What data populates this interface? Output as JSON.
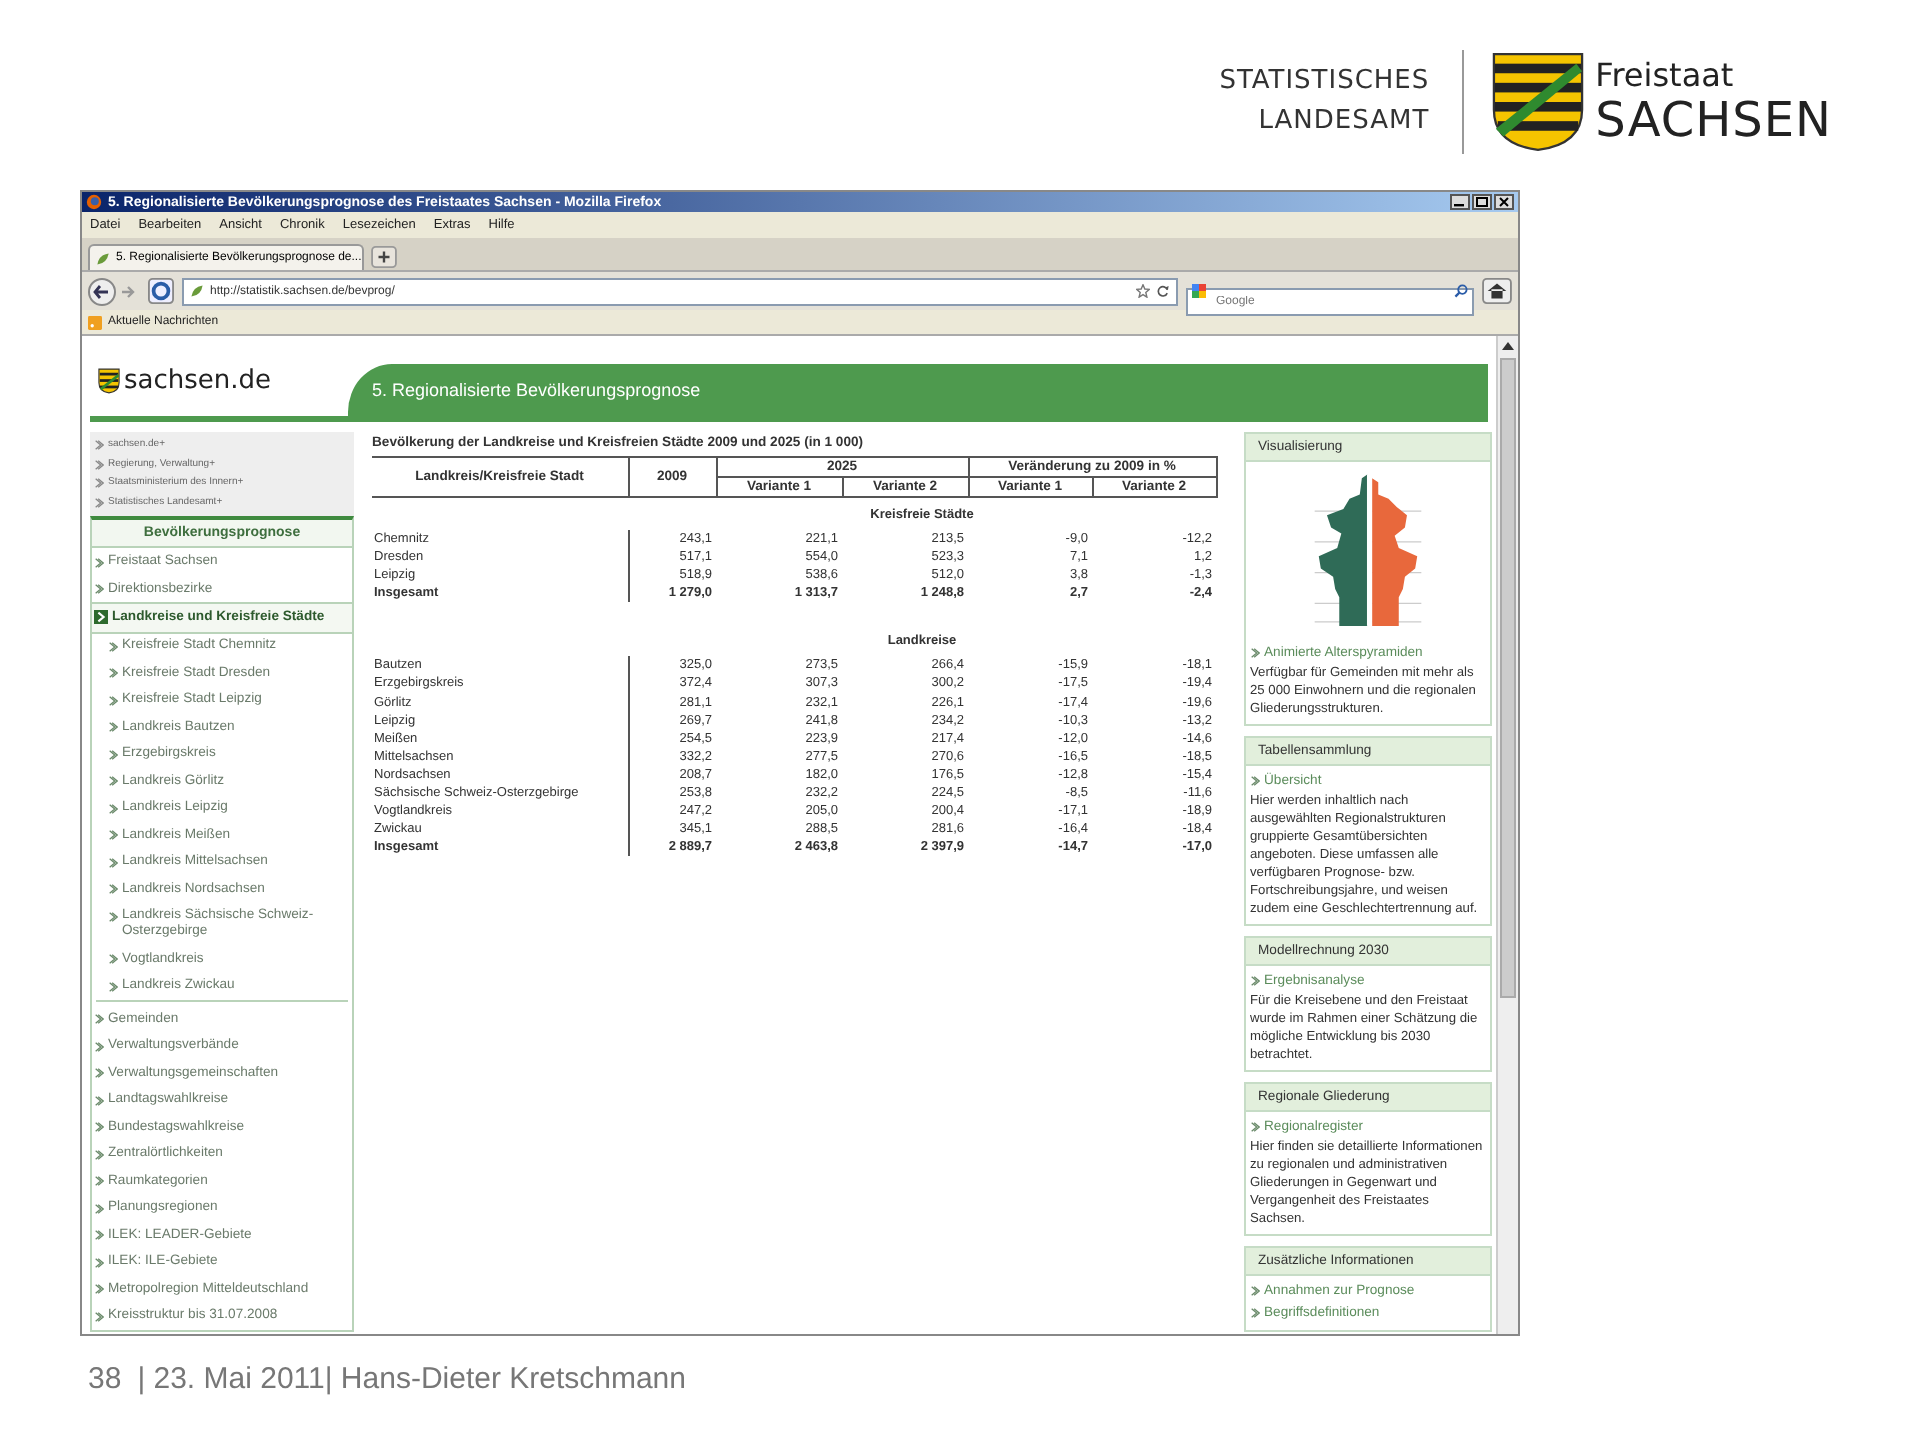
{
  "slide_header": {
    "office": [
      "STATISTISCHES",
      "LANDESAMT"
    ],
    "state": [
      "Freistaat",
      "SACHSEN"
    ]
  },
  "browser": {
    "title": "5. Regionalisierte Bevölkerungsprognose des Freistaates Sachsen - Mozilla Firefox",
    "menu": [
      "Datei",
      "Bearbeiten",
      "Ansicht",
      "Chronik",
      "Lesezeichen",
      "Extras",
      "Hilfe"
    ],
    "tab": "5. Regionalisierte Bevölkerungsprognose de...",
    "url": "http://statistik.sachsen.de/bevprog/",
    "search": {
      "placeholder": "Google"
    },
    "bookmarks": [
      "Aktuelle Nachrichten"
    ]
  },
  "site": {
    "logo": "sachsen.de",
    "banner": "5. Regionalisierte Bevölkerungsprognose"
  },
  "sidebar": {
    "top_links": [
      "sachsen.de+",
      "Regierung, Verwaltung+",
      "Staatsministerium des Innern+",
      "Statistisches Landesamt+"
    ],
    "heading": "Bevölkerungsprognose",
    "items": [
      {
        "label": "Freistaat Sachsen",
        "selected": false
      },
      {
        "label": "Direktionsbezirke",
        "selected": false
      },
      {
        "label": "Landkreise und Kreisfreie Städte",
        "selected": true,
        "children": [
          {
            "label": "Kreisfreie Stadt Chemnitz",
            "selected": false
          },
          {
            "label": "Kreisfreie Stadt Dresden",
            "selected": false
          },
          {
            "label": "Kreisfreie Stadt Leipzig",
            "selected": false
          },
          {
            "label": "Landkreis Bautzen",
            "selected": false
          },
          {
            "label": "Erzgebirgskreis",
            "selected": false
          },
          {
            "label": "Landkreis Görlitz",
            "selected": false
          },
          {
            "label": "Landkreis Leipzig",
            "selected": false
          },
          {
            "label": "Landkreis Meißen",
            "selected": false
          },
          {
            "label": "Landkreis Mittelsachsen",
            "selected": false
          },
          {
            "label": "Landkreis Nordsachsen",
            "selected": false
          },
          {
            "label": "Landkreis Sächsische Schweiz-Osterzgebirge",
            "selected": false
          },
          {
            "label": "Vogtlandkreis",
            "selected": false
          },
          {
            "label": "Landkreis Zwickau",
            "selected": false
          }
        ]
      },
      {
        "label": "Gemeinden",
        "selected": false
      },
      {
        "label": "Verwaltungsverbände",
        "selected": false
      },
      {
        "label": "Verwaltungsgemeinschaften",
        "selected": false
      },
      {
        "label": "Landtagswahlkreise",
        "selected": false
      },
      {
        "label": "Bundestagswahlkreise",
        "selected": false
      },
      {
        "label": "Zentralörtlichkeiten",
        "selected": false
      },
      {
        "label": "Raumkategorien",
        "selected": false
      },
      {
        "label": "Planungsregionen",
        "selected": false
      },
      {
        "label": "ILEK: LEADER-Gebiete",
        "selected": false
      },
      {
        "label": "ILEK: ILE-Gebiete",
        "selected": false
      },
      {
        "label": "Metropolregion Mitteldeutschland",
        "selected": false
      },
      {
        "label": "Kreisstruktur bis 31.07.2008",
        "selected": false
      }
    ]
  },
  "table": {
    "caption": "Bevölkerung der Landkreise und Kreisfreien Städte 2009 und 2025 (in 1 000)",
    "header": {
      "name": "Landkreis/Kreisfreie Stadt",
      "base": "2009",
      "groups": [
        "2025",
        "Veränderung zu 2009 in %"
      ],
      "variants": [
        "Variante 1",
        "Variante 2",
        "Variante 1",
        "Variante 2"
      ]
    },
    "sections": [
      {
        "title": "Kreisfreie Städte",
        "rows": [
          {
            "name": "Chemnitz",
            "values": [
              "243,1",
              "221,1",
              "213,5",
              "-9,0",
              "-12,2"
            ],
            "total": false
          },
          {
            "name": "Dresden",
            "values": [
              "517,1",
              "554,0",
              "523,3",
              "7,1",
              "1,2"
            ],
            "total": false
          },
          {
            "name": "Leipzig",
            "values": [
              "518,9",
              "538,6",
              "512,0",
              "3,8",
              "-1,3"
            ],
            "total": false
          },
          {
            "name": "Insgesamt",
            "values": [
              "1 279,0",
              "1 313,7",
              "1 248,8",
              "2,7",
              "-2,4"
            ],
            "total": true
          }
        ]
      },
      {
        "title": "Landkreise",
        "rows": [
          {
            "name": "Bautzen",
            "values": [
              "325,0",
              "273,5",
              "266,4",
              "-15,9",
              "-18,1"
            ],
            "total": false
          },
          {
            "name": "Erzgebirgskreis",
            "values": [
              "372,4",
              "307,3",
              "300,2",
              "-17,5",
              "-19,4"
            ],
            "total": false
          },
          {
            "name": "Görlitz",
            "values": [
              "281,1",
              "232,1",
              "226,1",
              "-17,4",
              "-19,6"
            ],
            "total": false
          },
          {
            "name": "Leipzig",
            "values": [
              "269,7",
              "241,8",
              "234,2",
              "-10,3",
              "-13,2"
            ],
            "total": false
          },
          {
            "name": "Meißen",
            "values": [
              "254,5",
              "223,9",
              "217,4",
              "-12,0",
              "-14,6"
            ],
            "total": false
          },
          {
            "name": "Mittelsachsen",
            "values": [
              "332,2",
              "277,5",
              "270,6",
              "-16,5",
              "-18,5"
            ],
            "total": false
          },
          {
            "name": "Nordsachsen",
            "values": [
              "208,7",
              "182,0",
              "176,5",
              "-12,8",
              "-15,4"
            ],
            "total": false
          },
          {
            "name": "Sächsische Schweiz-Osterzgebirge",
            "values": [
              "253,8",
              "232,2",
              "224,5",
              "-8,5",
              "-11,6"
            ],
            "total": false
          },
          {
            "name": "Vogtlandkreis",
            "values": [
              "247,2",
              "205,0",
              "200,4",
              "-17,1",
              "-18,9"
            ],
            "total": false
          },
          {
            "name": "Zwickau",
            "values": [
              "345,1",
              "288,5",
              "281,6",
              "-16,4",
              "-18,4"
            ],
            "total": false
          },
          {
            "name": "Insgesamt",
            "values": [
              "2 889,7",
              "2 463,8",
              "2 397,9",
              "-14,7",
              "-17,0"
            ],
            "total": true
          }
        ]
      }
    ]
  },
  "panels": [
    {
      "title": "Visualisierung",
      "kind": "pyramid",
      "links": [
        "Animierte Alterspyramiden"
      ],
      "text": "Verfügbar für Gemeinden mit mehr als 25 000 Einwohnern und die regionalen Gliederungsstrukturen."
    },
    {
      "title": "Tabellensammlung",
      "kind": "text",
      "links": [
        "Übersicht"
      ],
      "text": "Hier werden inhaltlich nach ausgewählten Regionalstrukturen gruppierte Gesamtübersichten angeboten. Diese umfassen alle verfügbaren Prognose- bzw. Fortschreibungsjahre, und weisen zudem eine Geschlechtertrennung auf."
    },
    {
      "title": "Modellrechnung 2030",
      "kind": "text",
      "links": [
        "Ergebnisanalyse"
      ],
      "text": "Für die Kreisebene und den Freistaat wurde im Rahmen einer Schätzung die mögliche Entwicklung bis 2030 betrachtet."
    },
    {
      "title": "Regionale Gliederung",
      "kind": "text",
      "links": [
        "Regionalregister"
      ],
      "text": "Hier finden sie detaillierte Informationen zu regionalen und administrativen Gliederungen in Gegenwart und Vergangenheit des Freistaates Sachsen."
    },
    {
      "title": "Zusätzliche Informationen",
      "kind": "text",
      "links": [
        "Annahmen zur Prognose",
        "Begriffsdefinitionen"
      ]
    }
  ],
  "footer": {
    "page": "38",
    "text": "| 23. Mai 2011| Hans-Dieter Kretschmann"
  }
}
